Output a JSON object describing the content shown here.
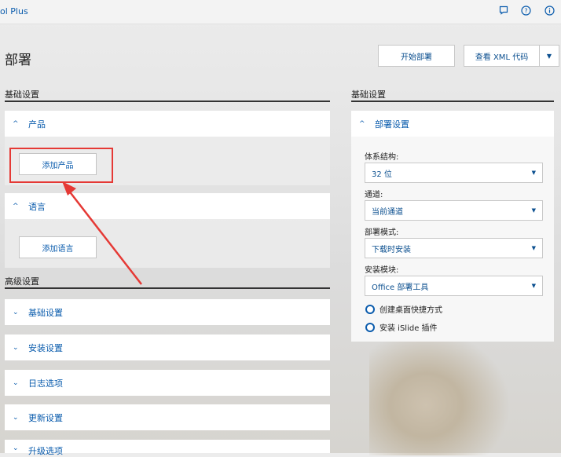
{
  "header": {
    "app_title": "ol Plus",
    "icons": [
      "feedback-icon",
      "help-icon",
      "info-icon"
    ]
  },
  "page": {
    "title": "部署"
  },
  "actions": {
    "start_deploy": "开始部署",
    "view_xml": "查看 XML 代码"
  },
  "basic_settings": {
    "title": "基础设置",
    "product_panel": {
      "label": "产品",
      "button": "添加产品"
    },
    "language_panel": {
      "label": "语言",
      "button": "添加语言"
    }
  },
  "advanced_settings": {
    "title": "高级设置",
    "items": [
      {
        "label": "基础设置"
      },
      {
        "label": "安装设置"
      },
      {
        "label": "日志选项"
      },
      {
        "label": "更新设置"
      },
      {
        "label": "升级选项"
      }
    ]
  },
  "right": {
    "section_title": "基础设置",
    "panel_label": "部署设置",
    "fields": [
      {
        "label": "体系结构:",
        "value": "32 位"
      },
      {
        "label": "通道:",
        "value": "当前通道"
      },
      {
        "label": "部署模式:",
        "value": "下载时安装"
      },
      {
        "label": "安装模块:",
        "value": "Office 部署工具"
      }
    ],
    "options": [
      {
        "label": "创建桌面快捷方式"
      },
      {
        "label": "安装 iSlide 插件"
      }
    ]
  },
  "colors": {
    "accent": "#0b5cad",
    "highlight": "#e53935"
  }
}
